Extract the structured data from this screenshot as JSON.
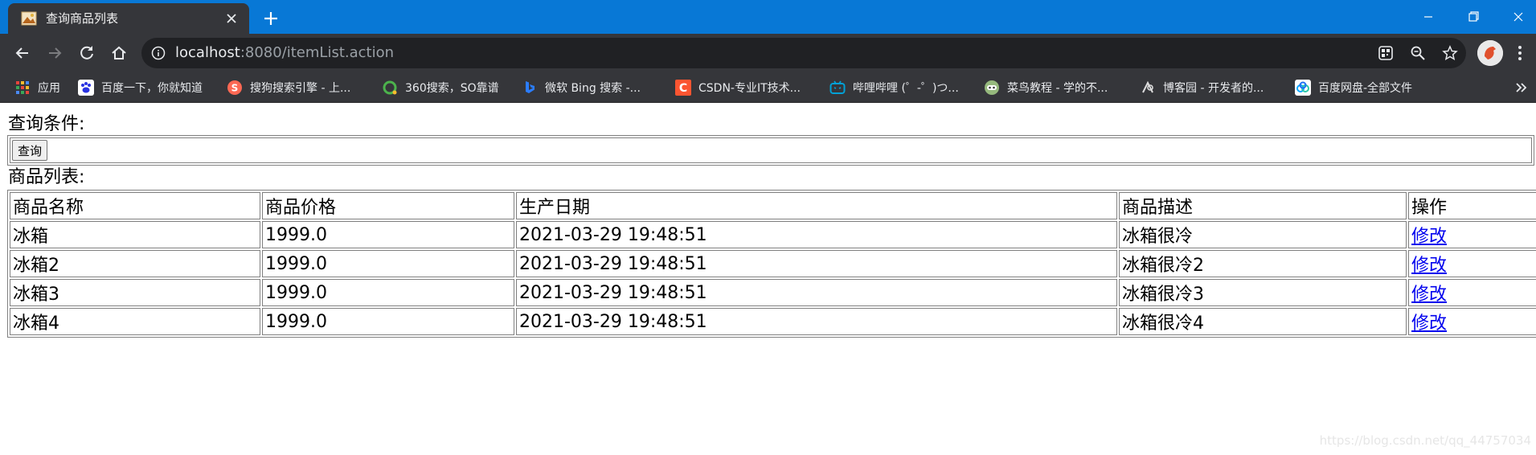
{
  "browser": {
    "tab": {
      "title": "查询商品列表",
      "favicon": "picture-icon"
    },
    "url": {
      "host": "localhost",
      "rest": ":8080/itemList.action"
    },
    "bookmarks": [
      {
        "label": "应用",
        "icon": "apps-grid-icon",
        "color": "#e8453c"
      },
      {
        "label": "百度一下，你就知道",
        "icon": "baidu-paw-icon",
        "color": "#2932e1"
      },
      {
        "label": "搜狗搜索引擎 - 上...",
        "icon": "sogou-icon",
        "color": "#fd6853"
      },
      {
        "label": "360搜索，SO靠谱",
        "icon": "360-search-icon",
        "color": "#4cb34c"
      },
      {
        "label": "微软 Bing 搜索 -...",
        "icon": "bing-icon",
        "color": "#2b7dff"
      },
      {
        "label": "CSDN-专业IT技术...",
        "icon": "csdn-icon",
        "color": "#fc5531"
      },
      {
        "label": "哔哩哔哩 (゜-゜)つ...",
        "icon": "bilibili-icon",
        "color": "#00a1d6"
      },
      {
        "label": "菜鸟教程 - 学的不...",
        "icon": "runoob-icon",
        "color": "#96b97d"
      },
      {
        "label": "博客园 - 开发者的...",
        "icon": "cnblogs-icon",
        "color": "#dddddd"
      },
      {
        "label": "百度网盘-全部文件",
        "icon": "baidu-netdisk-icon",
        "color": "#06a7ff"
      }
    ]
  },
  "page": {
    "query_label": "查询条件:",
    "query_button": "查询",
    "list_label": "商品列表:",
    "table": {
      "headers": [
        "商品名称",
        "商品价格",
        "生产日期",
        "商品描述",
        "操作"
      ],
      "rows": [
        {
          "name": "冰箱",
          "price": "1999.0",
          "date": "2021-03-29 19:48:51",
          "desc": "冰箱很冷",
          "action": "修改"
        },
        {
          "name": "冰箱2",
          "price": "1999.0",
          "date": "2021-03-29 19:48:51",
          "desc": "冰箱很冷2",
          "action": "修改"
        },
        {
          "name": "冰箱3",
          "price": "1999.0",
          "date": "2021-03-29 19:48:51",
          "desc": "冰箱很冷3",
          "action": "修改"
        },
        {
          "name": "冰箱4",
          "price": "1999.0",
          "date": "2021-03-29 19:48:51",
          "desc": "冰箱很冷4",
          "action": "修改"
        }
      ]
    },
    "watermark": "https://blog.csdn.net/qq_44757034"
  },
  "colors": {
    "titlebar": "#0878d6",
    "chrome_dark": "#35363a",
    "omnibox": "#202124",
    "link": "#0000ee"
  }
}
